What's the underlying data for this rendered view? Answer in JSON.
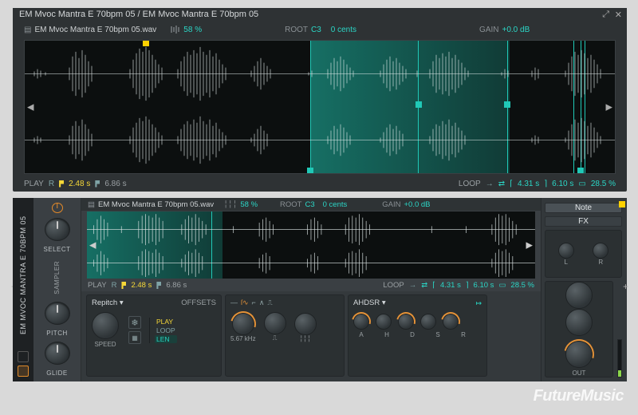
{
  "title": "EM Mvoc Mantra E 70bpm 05 / EM Mvoc Mantra E 70bpm 05",
  "file": {
    "name": "EM Mvoc Mantra E 70bpm 05.wav",
    "zoom": "58 %",
    "root_label": "ROOT",
    "root_note": "C3",
    "cents": "0 cents",
    "gain_label": "GAIN",
    "gain_value": "+0.0 dB"
  },
  "playstrip": {
    "play_label": "PLAY",
    "r": "R",
    "start": "2.48 s",
    "end_flag": "6.86 s",
    "loop_label": "LOOP",
    "loop_start": "4.31 s",
    "loop_end": "6.10 s",
    "loop_len": "28.5 %"
  },
  "device": {
    "name": "EM MVOC MANTRA E 70BPM 05",
    "section": "SAMPLER",
    "knobs": {
      "select": "SELECT",
      "pitch": "PITCH",
      "glide": "GLIDE"
    },
    "speed": {
      "mode": "Repitch ▾",
      "label": "SPEED",
      "offsets_hdr": "OFFSETS",
      "offsets": {
        "play": "PLAY",
        "loop": "LOOP",
        "len": "LEN"
      }
    },
    "osc": {
      "freq": "5.67 kHz"
    },
    "env": {
      "title": "AHDSR ▾",
      "a": "A",
      "h": "H",
      "d": "D",
      "s": "S",
      "r": "R"
    },
    "right": {
      "note": "Note",
      "fx": "FX",
      "l": "L",
      "r": "R",
      "out": "OUT"
    }
  },
  "watermark": "FutureMusic"
}
